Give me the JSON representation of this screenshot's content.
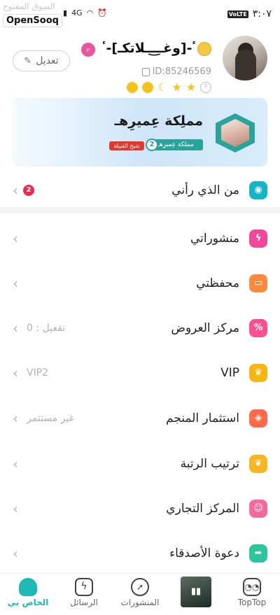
{
  "status_bar": {
    "watermark_text": "السوق المفتوح",
    "watermark_logo": "OpenSooq",
    "network": "4G",
    "time": "٣:٠٧",
    "volte": "VoLTE"
  },
  "profile": {
    "username": "ٴ-[وغــ͜ــلاتكـ]-ٴ",
    "user_id": "ID:85246569",
    "edit_label": "تعديل",
    "help_mark": "?"
  },
  "banner": {
    "title": "مملِكة عِميرِهـ",
    "tag": "مملكة عِميرِهـ",
    "level": "2",
    "chip": "شيخ القبيلة"
  },
  "menu": {
    "viewers": {
      "label": "من الذي رأني",
      "count": "2"
    },
    "posts": {
      "label": "منشوراتي"
    },
    "wallet": {
      "label": "محفظتي"
    },
    "offers": {
      "label": "مركز العروض",
      "value": "تفعيل : 0"
    },
    "vip": {
      "label": "VIP",
      "value": "VIP2"
    },
    "mine": {
      "label": "استثمار المنجم",
      "value": "غير مستثمر"
    },
    "rank": {
      "label": "ترتيب الرتبة"
    },
    "store": {
      "label": "المركز التجاري"
    },
    "invite": {
      "label": "دعوة الأصدقاء"
    }
  },
  "nav": {
    "mine": "الخاص بي",
    "messages": "الرسائل",
    "posts": "المنشورات",
    "toptop": "TopTop"
  },
  "colors": {
    "accent": "#1fb9b3",
    "viewers": "#14b4c9",
    "posts": "#f0479a",
    "wallet": "#ff8a3d",
    "offers": "#ff4f8f",
    "vip": "#f7b511",
    "mine": "#ff6b4a",
    "rank": "#f9b624",
    "store": "#f56a9a",
    "invite": "#2cc59c"
  }
}
